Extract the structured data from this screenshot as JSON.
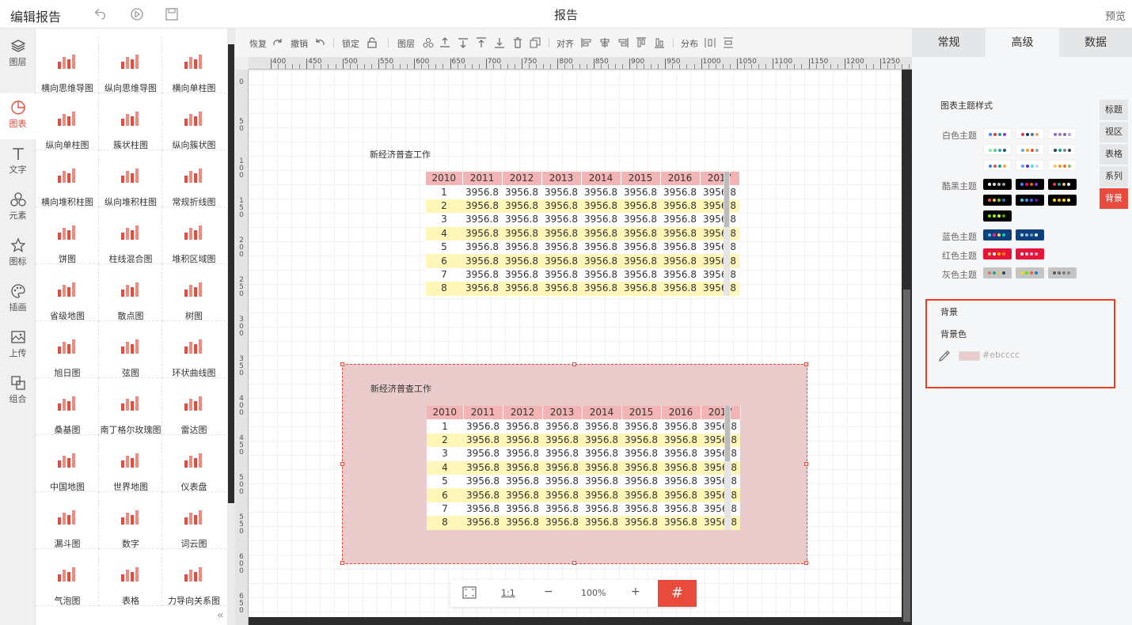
{
  "topbar": {
    "title": "编辑报告",
    "center": "报告",
    "preview": "预览"
  },
  "left_nav": [
    {
      "label": "图层",
      "icon": "layers-icon"
    },
    {
      "label": "图表",
      "icon": "chart-pie-icon",
      "active": true
    },
    {
      "label": "文字",
      "icon": "text-icon"
    },
    {
      "label": "元素",
      "icon": "elements-icon"
    },
    {
      "label": "图标",
      "icon": "star-icon"
    },
    {
      "label": "插画",
      "icon": "palette-icon"
    },
    {
      "label": "上传",
      "icon": "upload-image-icon"
    },
    {
      "label": "组合",
      "icon": "group-icon"
    }
  ],
  "gallery": [
    "横向思维导图",
    "纵向思维导图",
    "横向单柱图",
    "纵向单柱图",
    "簇状柱图",
    "纵向簇状图",
    "横向堆积柱图",
    "纵向堆积柱图",
    "常规折线图",
    "饼图",
    "柱线混合图",
    "堆积区域图",
    "省级地图",
    "散点图",
    "树图",
    "旭日图",
    "弦图",
    "环状曲线图",
    "桑基图",
    "南丁格尔玫瑰图",
    "雷达图",
    "中国地图",
    "世界地图",
    "仪表盘",
    "漏斗图",
    "数字",
    "词云图",
    "气泡图",
    "表格",
    "力导向关系图"
  ],
  "toolbar": {
    "redo": "恢复",
    "undo": "撤销",
    "lock": "锁定",
    "layer": "图层",
    "align": "对齐",
    "distribute": "分布"
  },
  "ruler_top": [
    "400",
    "450",
    "500",
    "550",
    "600",
    "650",
    "700",
    "750",
    "800",
    "850",
    "900",
    "950",
    "1000",
    "1050",
    "1100",
    "1150",
    "1200",
    "1250"
  ],
  "ruler_left": [
    "0",
    "50",
    "100",
    "150",
    "200",
    "250",
    "300",
    "350",
    "400",
    "450",
    "500",
    "550",
    "600",
    "650"
  ],
  "charts": [
    {
      "title": "新经济普查工作",
      "headers": [
        "2010",
        "2011",
        "2012",
        "2013",
        "2014",
        "2015",
        "2016",
        "2017"
      ],
      "rows": [
        [
          "1",
          "3956.8",
          "3956.8",
          "3956.8",
          "3956.8",
          "3956.8",
          "3956.8",
          "3956.8"
        ],
        [
          "2",
          "3956.8",
          "3956.8",
          "3956.8",
          "3956.8",
          "3956.8",
          "3956.8",
          "3956.8"
        ],
        [
          "3",
          "3956.8",
          "3956.8",
          "3956.8",
          "3956.8",
          "3956.8",
          "3956.8",
          "3956.8"
        ],
        [
          "4",
          "3956.8",
          "3956.8",
          "3956.8",
          "3956.8",
          "3956.8",
          "3956.8",
          "3956.8"
        ],
        [
          "5",
          "3956.8",
          "3956.8",
          "3956.8",
          "3956.8",
          "3956.8",
          "3956.8",
          "3956.8"
        ],
        [
          "6",
          "3956.8",
          "3956.8",
          "3956.8",
          "3956.8",
          "3956.8",
          "3956.8",
          "3956.8"
        ],
        [
          "7",
          "3956.8",
          "3956.8",
          "3956.8",
          "3956.8",
          "3956.8",
          "3956.8",
          "3956.8"
        ],
        [
          "8",
          "3956.8",
          "3956.8",
          "3956.8",
          "3956.8",
          "3956.8",
          "3956.8",
          "3956.8"
        ]
      ]
    },
    {
      "title": "新经济普查工作",
      "headers": [
        "2010",
        "2011",
        "2012",
        "2013",
        "2014",
        "2015",
        "2016",
        "2017"
      ],
      "rows": [
        [
          "1",
          "3956.8",
          "3956.8",
          "3956.8",
          "3956.8",
          "3956.8",
          "3956.8",
          "3956.8"
        ],
        [
          "2",
          "3956.8",
          "3956.8",
          "3956.8",
          "3956.8",
          "3956.8",
          "3956.8",
          "3956.8"
        ],
        [
          "3",
          "3956.8",
          "3956.8",
          "3956.8",
          "3956.8",
          "3956.8",
          "3956.8",
          "3956.8"
        ],
        [
          "4",
          "3956.8",
          "3956.8",
          "3956.8",
          "3956.8",
          "3956.8",
          "3956.8",
          "3956.8"
        ],
        [
          "5",
          "3956.8",
          "3956.8",
          "3956.8",
          "3956.8",
          "3956.8",
          "3956.8",
          "3956.8"
        ],
        [
          "6",
          "3956.8",
          "3956.8",
          "3956.8",
          "3956.8",
          "3956.8",
          "3956.8",
          "3956.8"
        ],
        [
          "7",
          "3956.8",
          "3956.8",
          "3956.8",
          "3956.8",
          "3956.8",
          "3956.8",
          "3956.8"
        ],
        [
          "8",
          "3956.8",
          "3956.8",
          "3956.8",
          "3956.8",
          "3956.8",
          "3956.8",
          "3956.8"
        ]
      ],
      "background": "#ebcccc"
    }
  ],
  "zoombar": {
    "ratio": "1:1",
    "minus": "−",
    "zoom": "100%",
    "plus": "+"
  },
  "right_panel": {
    "tabs": [
      "常规",
      "高级",
      "数据"
    ],
    "active_tab": "高级",
    "side_tabs": [
      "标题",
      "视区",
      "表格",
      "系列",
      "背景"
    ],
    "active_side_tab": "背景",
    "theme_section": "图表主题样式",
    "themes": [
      {
        "label": "白色主题",
        "swatches": [
          {
            "bg": "#ffffff",
            "dots": [
              "#3a86ff",
              "#e63946",
              "#2a9d8f",
              "#8338ec"
            ]
          },
          {
            "bg": "#ffffff",
            "dots": [
              "#e63946",
              "#1d3557",
              "#457b9d",
              "#f4a261"
            ]
          },
          {
            "bg": "#ffffff",
            "dots": [
              "#9b5de5",
              "#8e7dbe",
              "#7b6ca8",
              "#b8a1d9"
            ]
          },
          {
            "bg": "#ffffff",
            "dots": [
              "#80ed99",
              "#57cc99",
              "#38a3a5",
              "#22577a"
            ]
          },
          {
            "bg": "#ffffff",
            "dots": [
              "#5dade2",
              "#f39c12",
              "#e74c3c",
              "#95a5a6"
            ]
          },
          {
            "bg": "#ffffff",
            "dots": [
              "#2c3e50",
              "#16a085",
              "#7f8c8d",
              "#34495e"
            ]
          },
          {
            "bg": "#ffffff",
            "dots": [
              "#2e86de",
              "#ee5253",
              "#10ac84",
              "#ff9f43"
            ]
          },
          {
            "bg": "#ffffff",
            "dots": [
              "#54a0ff",
              "#5f27cd",
              "#48dbfb",
              "#c8d6e5"
            ]
          },
          {
            "bg": "#ffffff",
            "dots": [
              "#f9c74f",
              "#f8961e",
              "#f3722c",
              "#90be6d"
            ]
          }
        ]
      },
      {
        "label": "酷黑主题",
        "swatches": [
          {
            "bg": "#000000",
            "dots": [
              "#ffffff",
              "#dddddd",
              "#bbbbbb",
              "#999999"
            ]
          },
          {
            "bg": "#000000",
            "dots": [
              "#3a86ff",
              "#ff006e",
              "#fb5607",
              "#8338ec"
            ]
          },
          {
            "bg": "#000000",
            "dots": [
              "#e63946",
              "#2a9d8f",
              "#e9c46a",
              "#f1faee"
            ]
          },
          {
            "bg": "#000000",
            "dots": [
              "#ff595e",
              "#ffca3a",
              "#8ac926",
              "#1982c4"
            ]
          },
          {
            "bg": "#000000",
            "dots": [
              "#4cc9f0",
              "#4895ef",
              "#4361ee",
              "#7209b7"
            ]
          },
          {
            "bg": "#000000",
            "dots": [
              "#ffd60a",
              "#ffc300",
              "#ffdd00",
              "#f9f871"
            ]
          },
          {
            "bg": "#000000",
            "dots": [
              "#70e000",
              "#9ef01a",
              "#ccff33",
              "#38b000"
            ]
          }
        ]
      },
      {
        "label": "蓝色主题",
        "swatches": [
          {
            "bg": "#0f3f7c",
            "dots": [
              "#4cc9f0",
              "#f72585",
              "#ffd166",
              "#06d6a0"
            ]
          },
          {
            "bg": "#0f3f7c",
            "dots": [
              "#a9d6e5",
              "#89c2d9",
              "#61a5c2",
              "#ffffff"
            ]
          }
        ]
      },
      {
        "label": "红色主题",
        "swatches": [
          {
            "bg": "#e8133b",
            "dots": [
              "#ffd166",
              "#ffffff",
              "#ffb703",
              "#fb8500"
            ]
          },
          {
            "bg": "#e8133b",
            "dots": [
              "#ffffff",
              "#ffe5ec",
              "#ffc2d1",
              "#ffb3c6"
            ]
          }
        ]
      },
      {
        "label": "灰色主题",
        "swatches": [
          {
            "bg": "#c4c4c4",
            "dots": [
              "#e76f51",
              "#2a9d8f",
              "#e9c46a",
              "#264653"
            ]
          },
          {
            "bg": "#c4c4c4",
            "dots": [
              "#ffd60a",
              "#70e000",
              "#ff595e",
              "#1982c4"
            ]
          },
          {
            "bg": "#c4c4c4",
            "dots": [
              "#555555",
              "#666666",
              "#777777",
              "#888888"
            ]
          }
        ]
      }
    ],
    "background": {
      "section": "背景",
      "color_label": "背景色",
      "value": "#ebcccc"
    }
  },
  "colors": {
    "accent": "#e84b3c",
    "highlight_border": "#f03c1e",
    "header_cell": "#f2b4b4",
    "zebra": "#fff6b8"
  }
}
